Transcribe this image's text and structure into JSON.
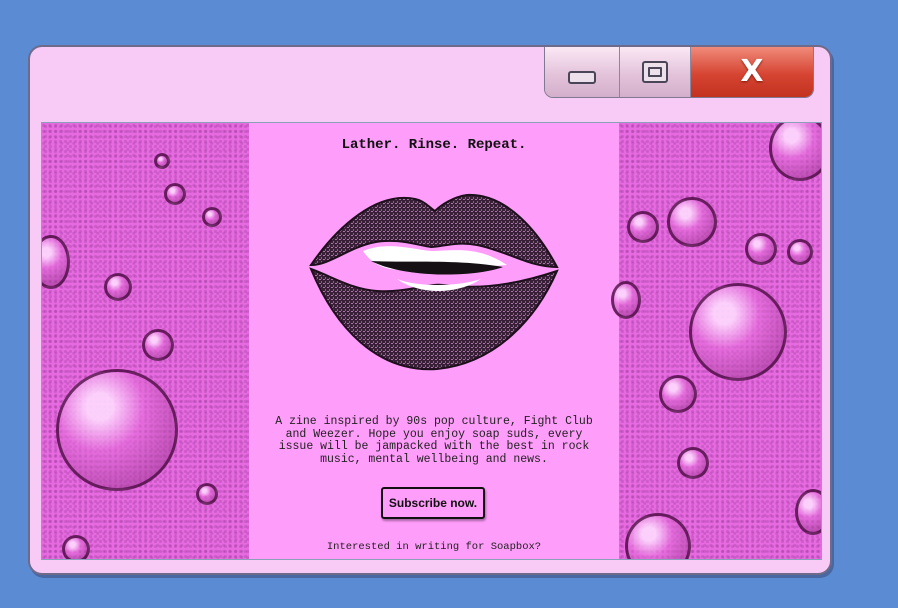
{
  "colors": {
    "desktop": "#5b8bd3",
    "window": "#f8caf6",
    "panel": "#ff9dfb",
    "close_button": "#d64432"
  },
  "window": {
    "controls": {
      "minimize_icon": "minimize-icon",
      "maximize_icon": "maximize-icon",
      "close_icon": "close-icon",
      "close_glyph": "X"
    }
  },
  "main": {
    "title": "Lather. Rinse. Repeat.",
    "description": "A zine inspired by 90s pop culture, Fight Club and Weezer. Hope you enjoy soap suds, every issue will be jampacked with the best in rock music, mental wellbeing and news.",
    "subscribe_label": "Subscribe now.",
    "writing_link": "Interested in writing for Soapbox?"
  }
}
